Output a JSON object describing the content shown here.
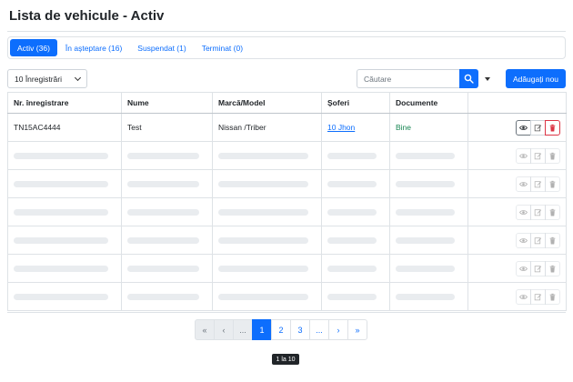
{
  "header": {
    "title": "Lista de vehicule - Activ"
  },
  "tabs": [
    {
      "label": "Activ (36)"
    },
    {
      "label": "În așteptare (16)"
    },
    {
      "label": "Suspendat (1)"
    },
    {
      "label": "Terminat (0)"
    }
  ],
  "toolbar": {
    "per_page": "10 Înregistrări",
    "search_placeholder": "Căutare",
    "add_label": "Adăugați nou"
  },
  "table": {
    "columns": [
      "Nr. înregistrare",
      "Nume",
      "Marcă/Model",
      "Șoferi",
      "Documente"
    ],
    "rows": [
      {
        "plate": "TN15AC4444",
        "name": "Test",
        "make_model": "Nissan /Triber",
        "drivers": "10 Jhon",
        "documents": "Bine"
      }
    ]
  },
  "pagination": {
    "items": [
      "«",
      "‹",
      "...",
      "1",
      "2",
      "3",
      "...",
      "›",
      "»"
    ],
    "current": "1"
  },
  "footer": {
    "range": "1 la 10"
  },
  "colors": {
    "primary": "#0d6efd",
    "success": "#198754",
    "danger": "#dc3545"
  }
}
